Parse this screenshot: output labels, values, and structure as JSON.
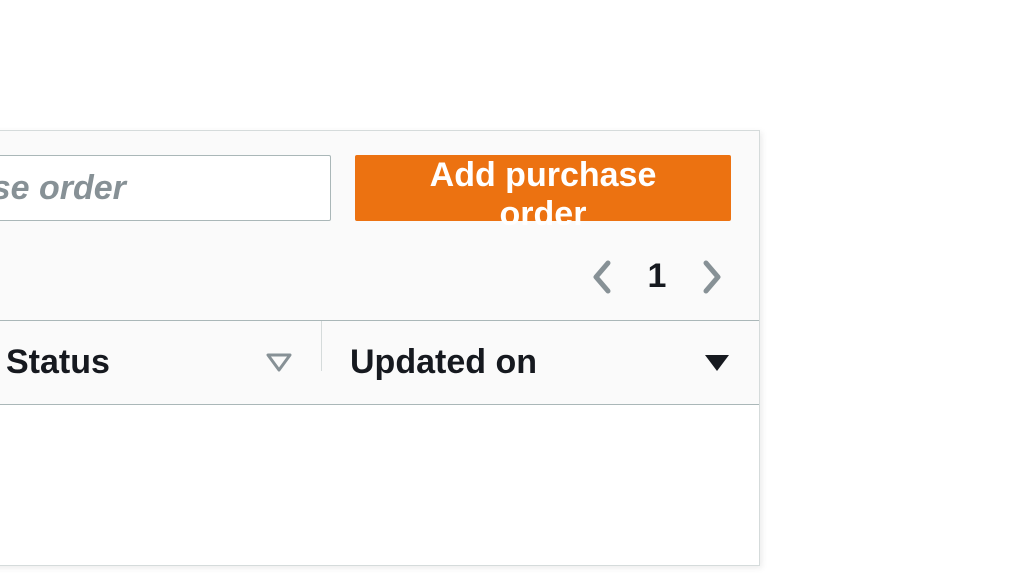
{
  "toolbar": {
    "search_placeholder": "e purchase order",
    "add_button_label": "Add purchase order"
  },
  "pagination": {
    "current_page": "1"
  },
  "table": {
    "columns": {
      "status": {
        "label": "Status"
      },
      "updated_on": {
        "label": "Updated on"
      }
    }
  },
  "colors": {
    "accent": "#ec7211",
    "text": "#16191f",
    "muted": "#879196",
    "border": "#aab7b8"
  }
}
